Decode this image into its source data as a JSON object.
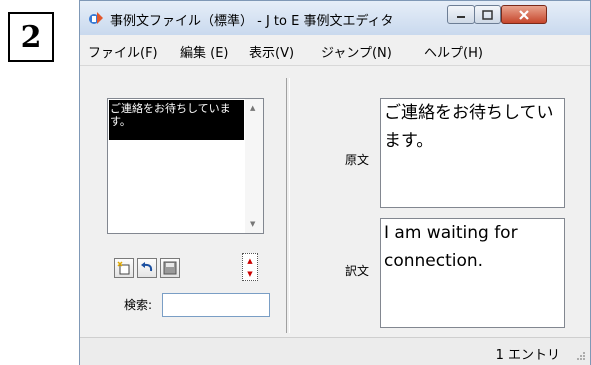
{
  "step_number": "2",
  "window": {
    "title": "事例文ファイル（標準） - J to E 事例文エディタ"
  },
  "menu": [
    "ファイル(F)",
    "編集 (E)",
    "表示(V)",
    "ジャンプ(N)",
    "ヘルプ(H)"
  ],
  "list": {
    "selected_item": "ご連絡をお待ちしています。"
  },
  "search": {
    "label": "検索:",
    "value": ""
  },
  "source": {
    "label": "原文",
    "text": "ご連絡をお待ちしています。"
  },
  "translation": {
    "label": "訳文",
    "text": "I am waiting for connection."
  },
  "status": {
    "entries": "1 エントリ"
  },
  "colors": {
    "selection_bg": "#000000",
    "close_button": "#c6462c",
    "titlebar": "#c9d9ee"
  }
}
